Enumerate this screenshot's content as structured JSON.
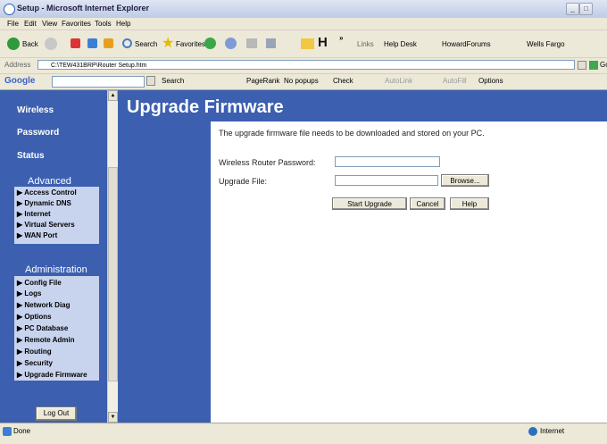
{
  "window": {
    "title": "Setup - Microsoft Internet Explorer"
  },
  "menu": [
    "File",
    "Edit",
    "View",
    "Favorites",
    "Tools",
    "Help"
  ],
  "toolbar": {
    "back": "Back",
    "search": "Search",
    "favorites": "Favorites",
    "links_label": "Links",
    "links": [
      "Help Desk",
      "HowardForums",
      "Wells Fargo"
    ]
  },
  "address": {
    "label": "Address",
    "value": "C:\\TEW431BRP\\Router Setup.htm",
    "go": "Go"
  },
  "googlebar": {
    "logo": "Google",
    "search": "Search",
    "pagerank": "PageRank",
    "popups": "No popups",
    "check": "Check",
    "autolink": "AutoLink",
    "autofill": "AutoFill",
    "options": "Options"
  },
  "nav": {
    "links": [
      "Wireless",
      "Password",
      "Status"
    ],
    "advanced": {
      "title": "Advanced",
      "items": [
        "Access Control",
        "Dynamic DNS",
        "Internet",
        "Virtual Servers",
        "WAN Port"
      ]
    },
    "administration": {
      "title": "Administration",
      "items": [
        "Config File",
        "Logs",
        "Network Diag",
        "Options",
        "PC Database",
        "Remote Admin",
        "Routing",
        "Security",
        "Upgrade Firmware"
      ]
    },
    "logout": "Log Out"
  },
  "main": {
    "title": "Upgrade Firmware",
    "intro": "The upgrade firmware file needs to be downloaded and stored on your PC.",
    "password_label": "Wireless Router Password:",
    "file_label": "Upgrade File:",
    "browse": "Browse...",
    "start": "Start Upgrade",
    "cancel": "Cancel",
    "help": "Help"
  },
  "status": {
    "text": "Done",
    "zone": "Internet"
  },
  "colors": {
    "nav_bg": "#3c5fb0",
    "nav_box": "#c8d3ee"
  }
}
